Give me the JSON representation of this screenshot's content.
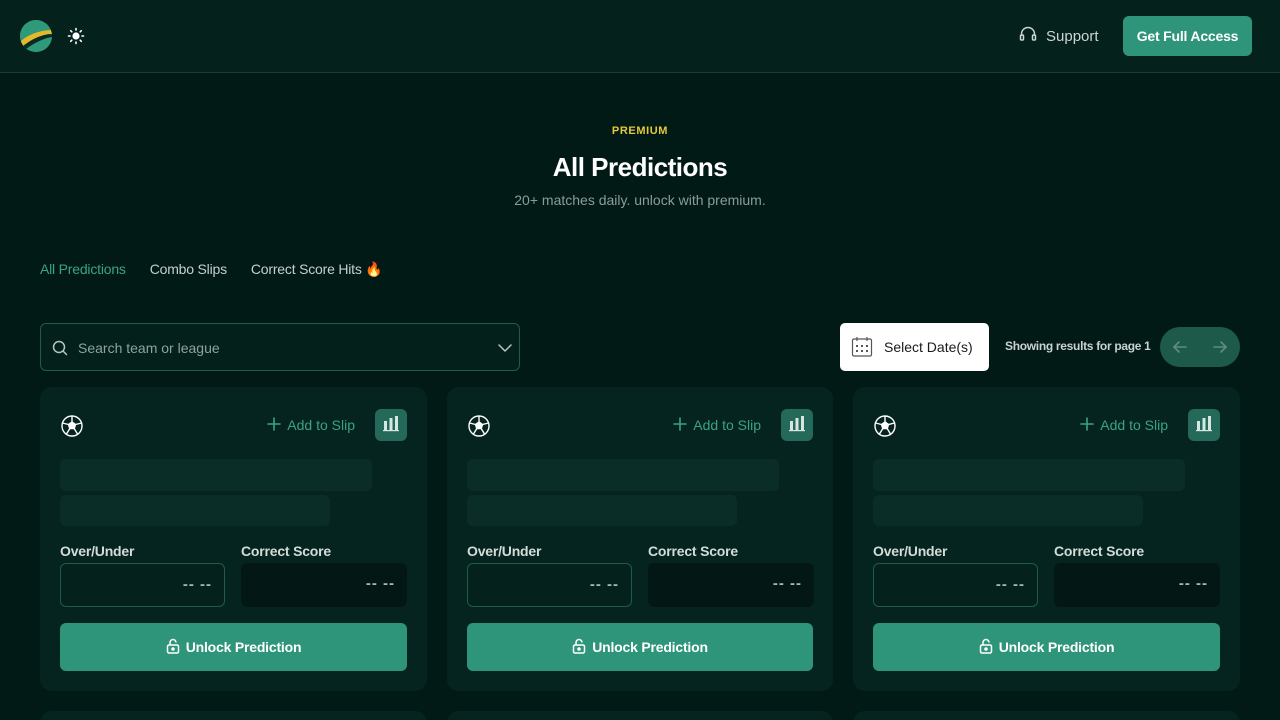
{
  "header": {
    "support_label": "Support",
    "cta_label": "Get Full Access"
  },
  "hero": {
    "eyebrow": "PREMIUM",
    "title": "All Predictions",
    "subtitle": "20+ matches daily. unlock with premium."
  },
  "tabs": [
    {
      "label": "All Predictions",
      "active": true
    },
    {
      "label": "Combo Slips",
      "active": false
    },
    {
      "label": "Correct Score Hits 🔥",
      "active": false
    }
  ],
  "filters": {
    "search_placeholder": "Search team or league",
    "date_label": "Select Date(s)",
    "showing_text": "Showing results for page 1"
  },
  "cards": [
    {
      "add_label": "Add to Slip",
      "ou_label": "Over/Under",
      "cs_label": "Correct Score",
      "ou_value": "-- --",
      "cs_value": "-- --",
      "unlock_label": "Unlock Prediction"
    },
    {
      "add_label": "Add to Slip",
      "ou_label": "Over/Under",
      "cs_label": "Correct Score",
      "ou_value": "-- --",
      "cs_value": "-- --",
      "unlock_label": "Unlock Prediction"
    },
    {
      "add_label": "Add to Slip",
      "ou_label": "Over/Under",
      "cs_label": "Correct Score",
      "ou_value": "-- --",
      "cs_value": "-- --",
      "unlock_label": "Unlock Prediction"
    }
  ],
  "colors": {
    "background": "#021a16",
    "accent": "#2e957b",
    "eyebrow": "#e5c93a"
  }
}
